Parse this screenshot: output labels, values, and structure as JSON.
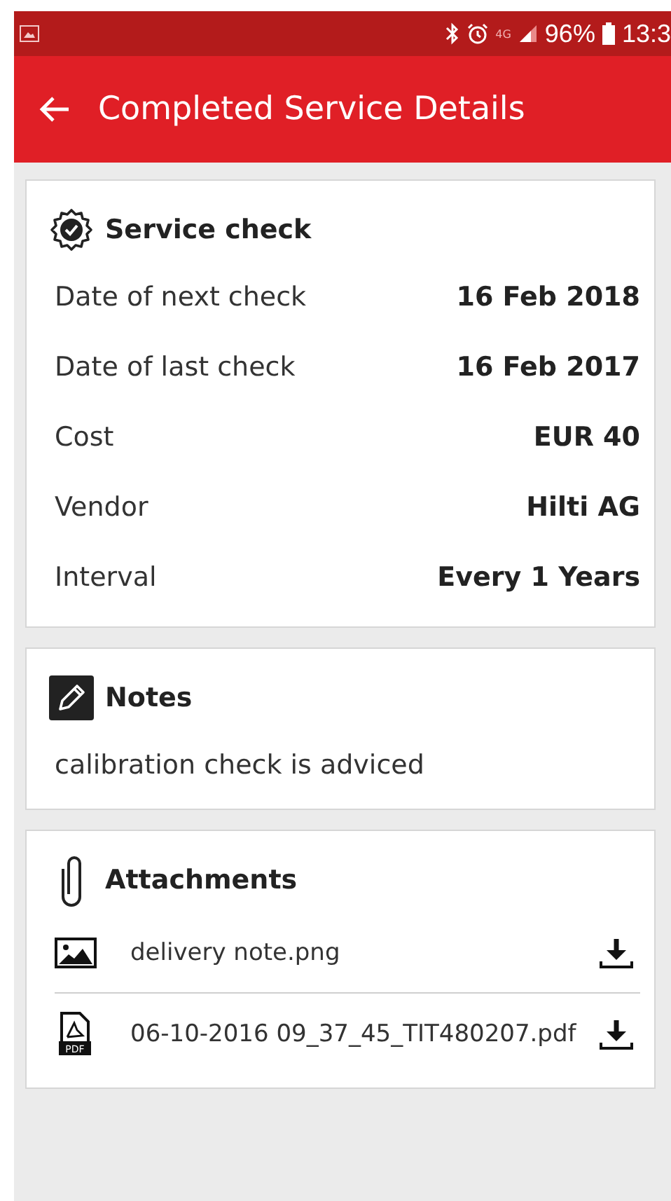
{
  "status_bar": {
    "network": "4G",
    "battery": "96%",
    "time": "13:3"
  },
  "app_bar": {
    "title": "Completed Service Details"
  },
  "service_check": {
    "title": "Service check",
    "rows": [
      {
        "label": "Date of next check",
        "value": "16 Feb 2018"
      },
      {
        "label": "Date of last check",
        "value": "16 Feb 2017"
      },
      {
        "label": "Cost",
        "value": "EUR 40"
      },
      {
        "label": "Vendor",
        "value": "Hilti AG"
      },
      {
        "label": "Interval",
        "value": "Every 1 Years"
      }
    ]
  },
  "notes": {
    "title": "Notes",
    "text": "calibration check is adviced"
  },
  "attachments": {
    "title": "Attachments",
    "items": [
      {
        "kind": "image",
        "name": "delivery note.png"
      },
      {
        "kind": "pdf",
        "name": "06-10-2016 09_37_45_TIT480207.pdf",
        "icon_text": "PDF"
      }
    ]
  }
}
